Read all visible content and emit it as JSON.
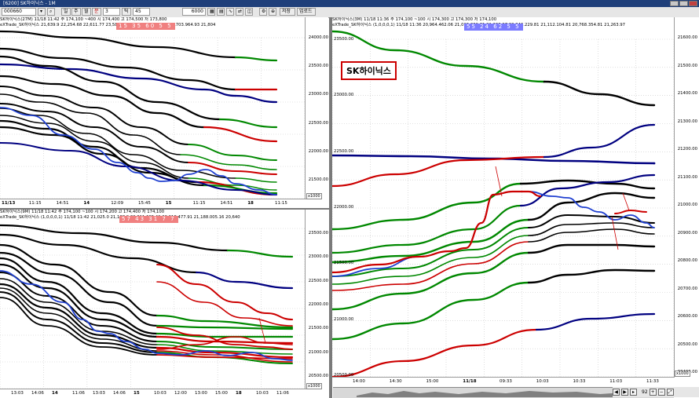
{
  "window": {
    "title": "[6200] SK하이닉스 - 1M"
  },
  "toolbar": {
    "code": "000660",
    "items": [
      "일",
      "주",
      "월",
      "분",
      "3",
      "틱",
      "45"
    ],
    "qty": "6000",
    "btn1": "저장",
    "btn2": "업로드"
  },
  "banner": "SK하이닉스",
  "panes": {
    "tl": {
      "line1": "SK하이닉스(27M)  11/18 11:42   주 174,100 ~400  시 174,400 고 174,500 저 173,800",
      "line2": "eXTrade_SK하이닉스   21,639.9   22,254.68  22,611.77   23,589.255.95  22,254.146.18  22,703.964.93 21,804",
      "signal": "15 35 60 5 5",
      "unit": "x1000",
      "yticks": [
        "24000.00",
        "23500.00",
        "23000.00",
        "22500.00",
        "22000.00",
        "21500.00"
      ],
      "xticks": [
        {
          "t": "11/13",
          "b": true
        },
        {
          "t": "11:15"
        },
        {
          "t": "14:51"
        },
        {
          "t": "14",
          "b": true
        },
        {
          "t": "12:09"
        },
        {
          "t": "15:45"
        },
        {
          "t": "15",
          "b": true
        },
        {
          "t": "11:15"
        },
        {
          "t": "14:51"
        },
        {
          "t": "18",
          "b": true
        },
        {
          "t": "11:15"
        }
      ]
    },
    "bl": {
      "line1": "SK하이닉스(9M)  11/18 11:42   주 174,100 ~100  시 174,200 고 174,400 저 174,100",
      "line2": "eXTrade_SK하이닉스  (1,0,0,0,1)  11/18 11:42   21,025.0  21,188.9  22,611,665.42  20,918.477.91  21,188.005.16  20,640",
      "signal": "57 43 31 7 7",
      "unit": "x1000",
      "yticks": [
        "23500.00",
        "23000.00",
        "22500.00",
        "22000.00",
        "21500.00",
        "21000.00",
        "20500.00"
      ],
      "xticks": [
        {
          "t": "13:03"
        },
        {
          "t": "14:06"
        },
        {
          "t": "14",
          "b": true
        },
        {
          "t": "11:06"
        },
        {
          "t": "13:03"
        },
        {
          "t": "14:06"
        },
        {
          "t": "15",
          "b": true
        },
        {
          "t": "10:03"
        },
        {
          "t": "12:00"
        },
        {
          "t": "13:00"
        },
        {
          "t": "15:00"
        },
        {
          "t": "18",
          "b": true
        },
        {
          "t": "10:03"
        },
        {
          "t": "11:06"
        }
      ]
    },
    "right": {
      "line1": "SK하이닉스(3M)  11/18 11:36   주 174,100 ~100  시 174,300 고 174,300 저 174,100",
      "line2": "eXTrade_SK하이닉스  (1,0,0,0,1)  11/18 11:36  20,964.462.06  21,015.369.31  21,263.97  20,940.229.81  21,112.104.81  20,768.354.81  21,263.97",
      "signal": "55 24 62 5 5",
      "unit": "x1000",
      "yticks": [
        "21600.00",
        "21500.00",
        "21400.00",
        "21300.00",
        "21200.00",
        "21100.00",
        "21000.00",
        "20900.00",
        "20800.00",
        "20700.00",
        "20600.00",
        "20500.00",
        "20400.00"
      ],
      "ylticks": [
        "23500.00",
        "23000.00",
        "22500.00",
        "22000.00",
        "21500.00",
        "21000.00",
        "20500.00"
      ],
      "xticks": [
        {
          "t": "14:00"
        },
        {
          "t": "14:30"
        },
        {
          "t": "15:00"
        },
        {
          "t": "11/18",
          "b": true
        },
        {
          "t": "09:33"
        },
        {
          "t": "10:03"
        },
        {
          "t": "10:33"
        },
        {
          "t": "11:03"
        },
        {
          "t": "11:33"
        }
      ],
      "nav": {
        "zoom": "92"
      }
    }
  }
}
